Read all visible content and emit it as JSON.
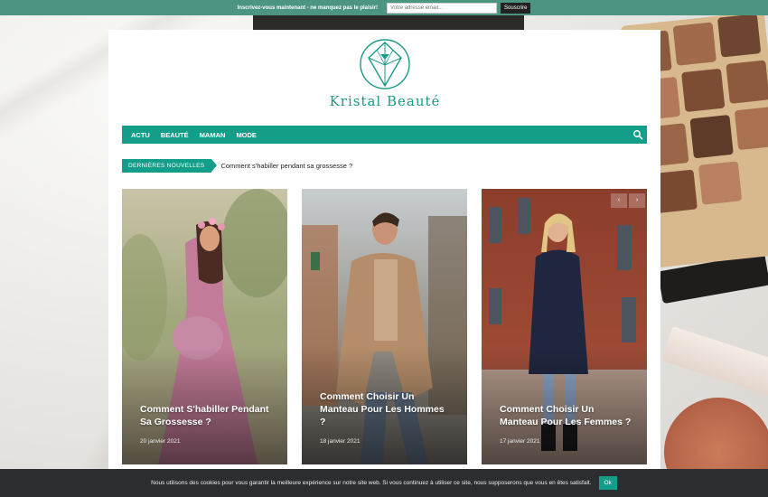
{
  "newsletter": {
    "message": "Inscrivez-vous maintenant - ne manquez pas le plaisir!",
    "email_placeholder": "Votre adresse email...",
    "subscribe_label": "Souscrire"
  },
  "site": {
    "brand": "Kristal Beauté"
  },
  "nav": {
    "items": [
      "ACTU",
      "BEAUTÉ",
      "MAMAN",
      "MODE"
    ],
    "search_icon": "search-icon"
  },
  "ticker": {
    "label": "DERNIÈRES NOUVELLES",
    "headline": "Comment s'habiller pendant sa grossesse ?"
  },
  "slider": {
    "prev_label": "‹",
    "next_label": "›",
    "cards": [
      {
        "title": "Comment S'habiller Pendant Sa Grossesse ?",
        "date": "20 janvier 2021"
      },
      {
        "title": "Comment Choisir Un Manteau Pour Les Hommes ?",
        "date": "18 janvier 2021"
      },
      {
        "title": "Comment Choisir Un Manteau Pour Les Femmes ?",
        "date": "17 janvier 2021"
      }
    ]
  },
  "cookie": {
    "text": "Nous utilisons des cookies pour vous garantir la meilleure expérience sur notre site web. Si vous continuez à utiliser ce site, nous supposerons que vous en êtes satisfait.",
    "ok_label": "Ok"
  },
  "colors": {
    "accent": "#139e8a",
    "topbar": "#4d9583",
    "cookiebar": "#2b2d31"
  }
}
